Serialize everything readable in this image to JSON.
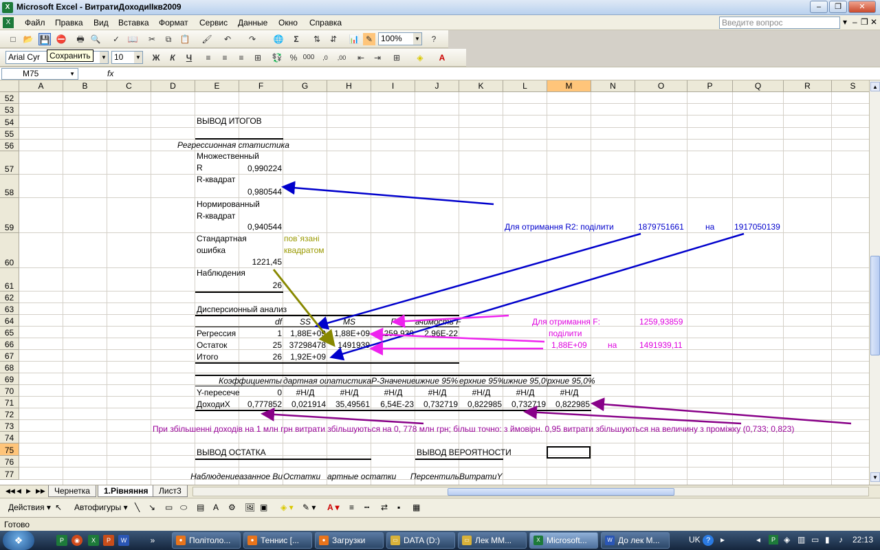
{
  "title": "Microsoft Excel - ВитратиДоходиІІкв2009",
  "menu": [
    "Файл",
    "Правка",
    "Вид",
    "Вставка",
    "Формат",
    "Сервис",
    "Данные",
    "Окно",
    "Справка"
  ],
  "ask_placeholder": "Введите вопрос",
  "toolbar": {
    "zoom": "100%",
    "font": "Arial Cyr",
    "size": "10",
    "tooltip": "Сохранить"
  },
  "namebox": "M75",
  "fx": "fx",
  "columns": [
    "A",
    "B",
    "C",
    "D",
    "E",
    "F",
    "G",
    "H",
    "I",
    "J",
    "K",
    "L",
    "M",
    "N",
    "O",
    "P",
    "Q",
    "R",
    "S"
  ],
  "rows": [
    "52",
    "53",
    "54",
    "55",
    "56",
    "57",
    "58",
    "59",
    "60",
    "61",
    "62",
    "63",
    "64",
    "65",
    "66",
    "67",
    "68",
    "69",
    "70",
    "71",
    "72",
    "73",
    "74",
    "75",
    "76",
    "77"
  ],
  "cells": {
    "e54": "ВЫВОД ИТОГОВ",
    "e56": "Регрессионная статистика",
    "e57": "Множественный R",
    "f57": "0,990224",
    "e58": "R-квадрат",
    "f58": "0,980544",
    "e59": "Нормированный R-квадрат",
    "f59": "0,940544",
    "e60": "Стандартная ошибка",
    "f60": "1221,45",
    "g60": "пов`язані квадратом",
    "e61": "Наблюдения",
    "f61": "26",
    "e63": "Дисперсионный анализ",
    "f64": "df",
    "g64": "SS",
    "h64": "MS",
    "i64": "F",
    "j64": "ачимость F",
    "e65": "Регрессия",
    "f65": "1",
    "g65": "1,88E+09",
    "h65": "1,88E+09",
    "i65": "1259,939",
    "j65": "2,96E-22",
    "e66": "Остаток",
    "f66": "25",
    "g66": "37298478",
    "h66": "1491939",
    "e67": "Итого",
    "f67": "26",
    "g67": "1,92E+09",
    "e69": "Коэффициенты",
    "f69": "дартная ош",
    "g69": "t-статистика",
    "h69": "P-Значение",
    "i69": "ижние 95%",
    "j69": "ерхние 95%",
    "k69": "ижние 95,0%",
    "l69": "рхние 95,0%",
    "e70": "Y-пересечение",
    "f70": "0",
    "g70": "#Н/Д",
    "h70": "#Н/Д",
    "i70": "#Н/Д",
    "j70": "#Н/Д",
    "k70": "#Н/Д",
    "l70": "#Н/Д",
    "m70": "#Н/Д",
    "e71": "ДоходиX",
    "f71": "0,777852",
    "g71": "0,021914",
    "h71": "35,49561",
    "i71": "6,54E-23",
    "j71": "0,732719",
    "k71": "0,822985",
    "l71": "0,732719",
    "m71": "0,822985",
    "e75": "ВЫВОД ОСТАТКА",
    "j75": "ВЫВОД ВЕРОЯТНОСТИ",
    "e77": "Наблюдение",
    "f77": "азанное Ви",
    "g77": "Остатки",
    "h77": "артные остатки",
    "j77": "Персентиль",
    "k77": "ВитратиY"
  },
  "notes": {
    "r2_text": "Для отримання R2: поділити",
    "r2_val1": "1879751661",
    "r2_on": "на",
    "r2_val2": "1917050139",
    "f_text": "Для отримання F:",
    "f_val": "1259,93859",
    "f_div": "поділити",
    "f_v1": "1,88E+09",
    "f_on": "на",
    "f_v2": "1491939,11",
    "row73": "При збільшенні доходів на 1 млн грн витрати збільшуються на  0, 778 млн грн; більш точно: з ймовірн. 0,95 витрати збільшуються на величину з проміжку (0,733; 0,823)"
  },
  "sheets": [
    "Чернетка",
    "1.Рівняння",
    "Лист3"
  ],
  "drawing": {
    "actions": "Действия",
    "autoshapes": "Автофигуры"
  },
  "status": "Готово",
  "taskbar": {
    "items": [
      "Політоло...",
      "Теннис [...",
      "Загрузки",
      "DATA (D:)",
      "Лек ММ...",
      "Microsoft...",
      "До лек М..."
    ],
    "lang": "UK",
    "clock": "22:13"
  },
  "colors": {
    "blue_note": "#0000cc",
    "magenta_note": "#dd00dd",
    "purple_note": "#990099",
    "olive_note": "#999900"
  }
}
